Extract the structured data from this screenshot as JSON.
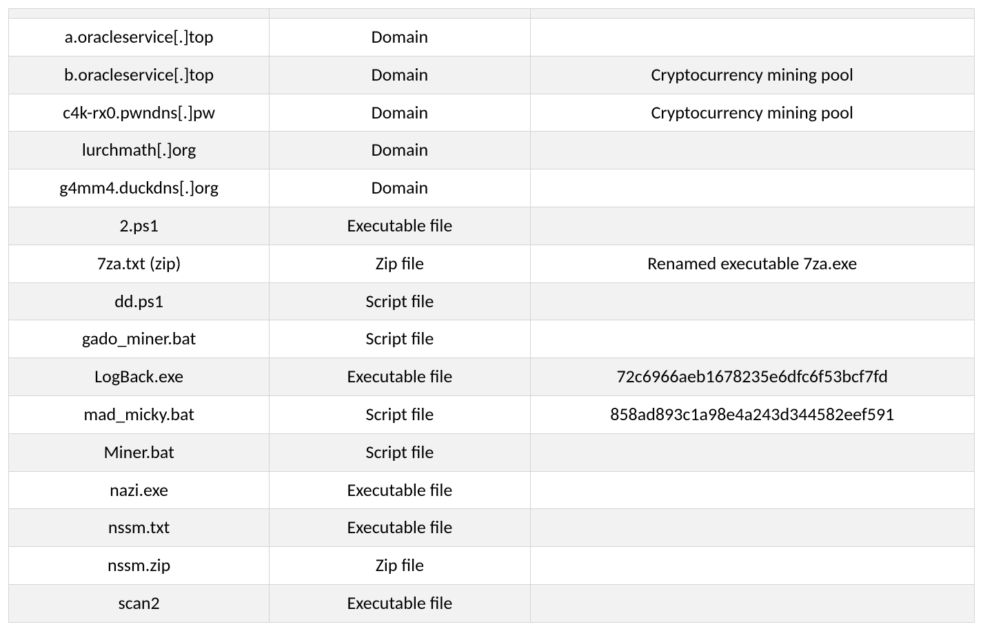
{
  "table": {
    "rows": [
      {
        "indicator": "a.oracleservice[.]top",
        "type": "Domain",
        "note": ""
      },
      {
        "indicator": "b.oracleservice[.]top",
        "type": "Domain",
        "note": "Cryptocurrency mining pool"
      },
      {
        "indicator": "c4k-rx0.pwndns[.]pw",
        "type": "Domain",
        "note": "Cryptocurrency mining pool"
      },
      {
        "indicator": "lurchmath[.]org",
        "type": "Domain",
        "note": ""
      },
      {
        "indicator": "g4mm4.duckdns[.]org",
        "type": "Domain",
        "note": ""
      },
      {
        "indicator": "2.ps1",
        "type": "Executable file",
        "note": ""
      },
      {
        "indicator": "7za.txt (zip)",
        "type": "Zip file",
        "note": "Renamed executable 7za.exe"
      },
      {
        "indicator": "dd.ps1",
        "type": "Script file",
        "note": ""
      },
      {
        "indicator": "gado_miner.bat",
        "type": "Script file",
        "note": ""
      },
      {
        "indicator": "LogBack.exe",
        "type": "Executable file",
        "note": "72c6966aeb1678235e6dfc6f53bcf7fd"
      },
      {
        "indicator": "mad_micky.bat",
        "type": "Script file",
        "note": "858ad893c1a98e4a243d344582eef591"
      },
      {
        "indicator": "Miner.bat",
        "type": "Script file",
        "note": ""
      },
      {
        "indicator": "nazi.exe",
        "type": "Executable file",
        "note": ""
      },
      {
        "indicator": "nssm.txt",
        "type": "Executable file",
        "note": ""
      },
      {
        "indicator": "nssm.zip",
        "type": "Zip file",
        "note": ""
      },
      {
        "indicator": "scan2",
        "type": "Executable file",
        "note": ""
      }
    ]
  }
}
